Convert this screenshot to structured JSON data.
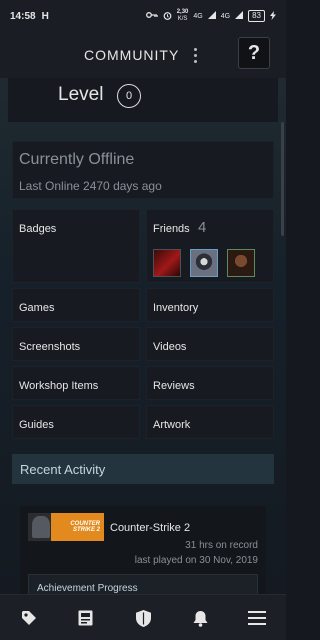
{
  "status_bar": {
    "time": "14:58",
    "app_icon": "H",
    "network": "2,30",
    "network_unit": "K/S",
    "signal": "4G",
    "signal2": "4G",
    "battery": "83"
  },
  "header": {
    "title": "COMMUNITY",
    "help_label": "?"
  },
  "level": {
    "label": "Level",
    "value": "0"
  },
  "profile_status": {
    "state": "Currently Offline",
    "last_online": "Last Online 2470 days ago"
  },
  "tiles": {
    "badges": "Badges",
    "friends": "Friends",
    "friends_count": "4",
    "games": "Games",
    "inventory": "Inventory",
    "screenshots": "Screenshots",
    "videos": "Videos",
    "workshop": "Workshop Items",
    "reviews": "Reviews",
    "guides": "Guides",
    "artwork": "Artwork"
  },
  "recent_activity": {
    "title": "Recent Activity",
    "game": {
      "logo_text": "COUNTER STRIKE 2",
      "name": "Counter-Strike 2",
      "hours": "31 hrs on record",
      "last_played": "last played on 30 Nov, 2019",
      "achievement_label": "Achievement Progress"
    }
  },
  "bottom_nav": [
    "tag-icon",
    "news-icon",
    "shield-icon",
    "bell-icon",
    "menu-icon"
  ]
}
